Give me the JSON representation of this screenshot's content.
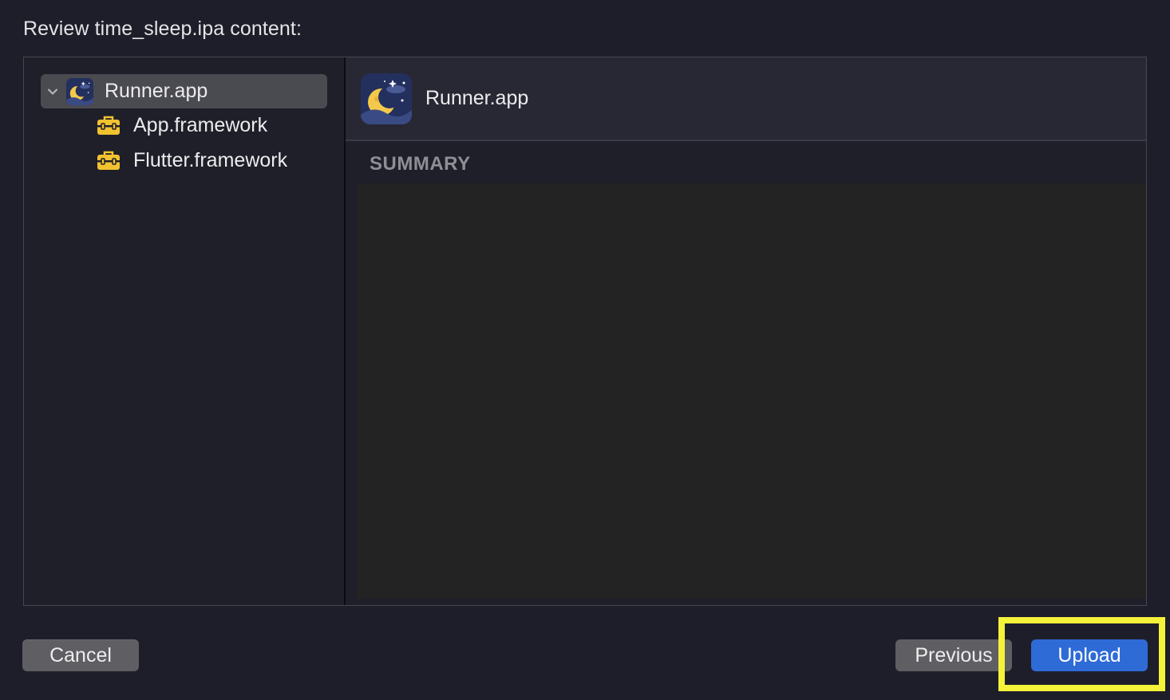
{
  "window": {
    "header": "Review time_sleep.ipa content:"
  },
  "sidebar": {
    "items": [
      {
        "label": "Runner.app",
        "icon": "app-icon",
        "expanded": true,
        "selected": true
      },
      {
        "label": "App.framework",
        "icon": "toolbox-icon"
      },
      {
        "label": "Flutter.framework",
        "icon": "toolbox-icon"
      }
    ]
  },
  "detail": {
    "title": "Runner.app",
    "icon": "app-icon",
    "section_label": "SUMMARY"
  },
  "buttons": {
    "cancel": "Cancel",
    "previous": "Previous",
    "upload": "Upload"
  },
  "colors": {
    "background": "#1e1e2a",
    "selection": "#4a4a51",
    "primary_button": "#2e6bd6",
    "highlight": "#f5f23a",
    "toolbox": "#f2c230"
  }
}
